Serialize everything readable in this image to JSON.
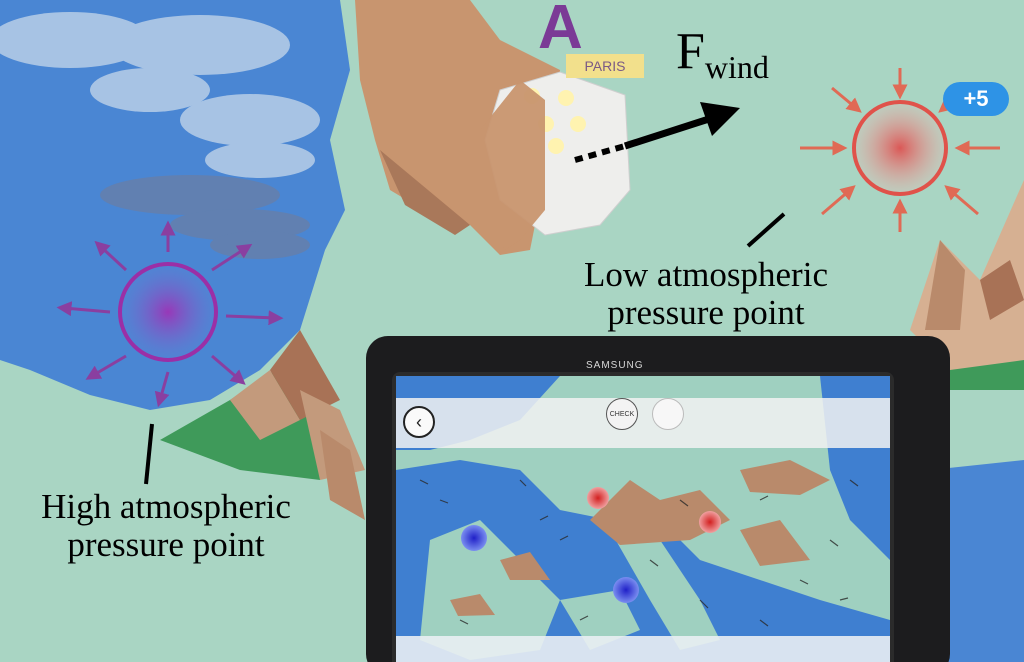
{
  "scene": {
    "annotations": {
      "force_label_main": "F",
      "force_label_sub": "wind",
      "low_pressure_line1": "Low atmospheric",
      "low_pressure_line2": "pressure point",
      "high_pressure_line1": "High atmospheric",
      "high_pressure_line2": "pressure point"
    },
    "board": {
      "letter": "A",
      "label": "PARIS",
      "bonus_badge": "+5"
    },
    "tablet": {
      "brand": "SAMSUNG",
      "check_label": "CHECK"
    },
    "colors": {
      "sea": "#3f7fd0",
      "land": "#a9d5c3",
      "high_pressure": "#9b2fa6",
      "low_pressure": "#e0524a",
      "mountain": "#b98a6b"
    },
    "icons": [
      "back-arrow-icon",
      "reset-icon",
      "wind-arrow-icon"
    ]
  }
}
